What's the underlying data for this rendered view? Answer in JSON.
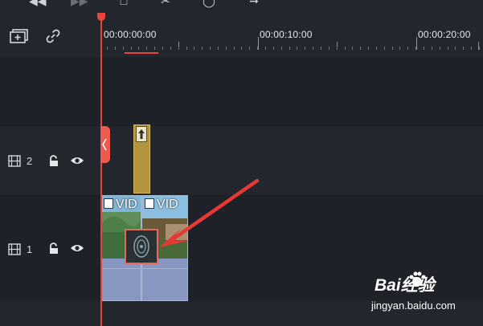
{
  "toolbar": {
    "icons": [
      "rewind-icon",
      "forward-icon",
      "delete-icon",
      "scissors-icon",
      "speed-icon",
      "export-arrow-icon"
    ]
  },
  "header": {
    "add_track_icon": "add-track-icon",
    "link_icon": "link-icon"
  },
  "ruler": {
    "timecodes": [
      "00:00:00:00",
      "00:00:10:00",
      "00:00:20:00"
    ]
  },
  "tracks": [
    {
      "id": "track-2",
      "number": "2",
      "icons": [
        "film-icon",
        "lock-icon",
        "eye-icon"
      ]
    },
    {
      "id": "track-1",
      "number": "1",
      "icons": [
        "film-icon",
        "lock-icon",
        "eye-icon"
      ]
    }
  ],
  "clips": {
    "video_labels": [
      "VID",
      "VID"
    ]
  },
  "watermark": {
    "brand": "Bai经验",
    "url": "jingyan.baidu.com"
  },
  "colors": {
    "playhead": "#e8453c",
    "title_clip": "#b3953f",
    "video_clip": "#8797c1",
    "annotation_arrow": "#e53935"
  }
}
